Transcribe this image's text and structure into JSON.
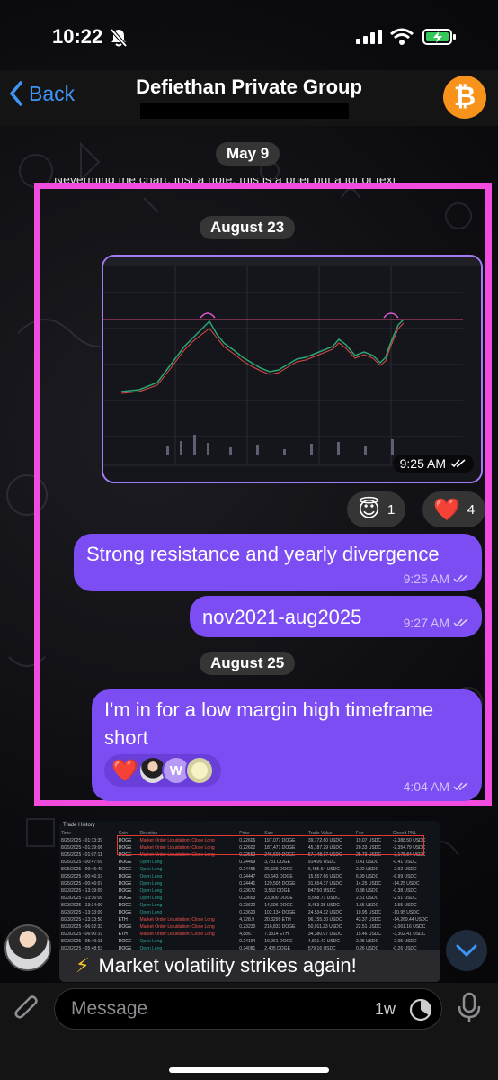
{
  "status_bar": {
    "time": "10:22"
  },
  "nav": {
    "back_label": "Back",
    "title": "Defiethan Private Group",
    "avatar_symbol": "₿",
    "avatar_color": "#f7931a"
  },
  "chat": {
    "date_may": "May 9",
    "date_aug23": "August 23",
    "date_aug25": "August 25",
    "image_time": "9:25 AM",
    "reaction_halo": {
      "emoji": "😇",
      "count": "1"
    },
    "reaction_heart": {
      "emoji": "❤️",
      "count": "4"
    },
    "msg1": {
      "text": "Strong resistance and yearly divergence",
      "time": "9:25 AM"
    },
    "msg2": {
      "text": "nov2021-aug2025",
      "time": "9:27 AM"
    },
    "msg3": {
      "text": "I'm in for a low margin high timeframe short",
      "time": "4:04 AM",
      "reaction": "❤️",
      "reactor_initial": "W"
    },
    "caption": "Market volatility strikes again!",
    "caption_icon": "⚡"
  },
  "trade_history": {
    "title": "Trade History",
    "headers": [
      "Time",
      "Coin",
      "Direction",
      "Price",
      "Size",
      "Trade Value",
      "Fee",
      "Closed PNL"
    ],
    "rows": [
      [
        "8/25/2025 - 01:13:39",
        "DOGE",
        "Market Order Liquidation: Close Long",
        "0.22606",
        "197,077 DOGE",
        "39,772.60 USDC",
        "19.07 USDC",
        "-2,388.50 USDC"
      ],
      [
        "8/25/2025 - 01:39:06",
        "DOGE",
        "Market Order Liquidation: Close Long",
        "0.22602",
        "187,471 DOGE",
        "45,187.29 USDC",
        "20.33 USDC",
        "-2,354.79 USDC"
      ],
      [
        "8/25/2025 - 01:07:11",
        "DOGE",
        "Market Order Liquidation: Close Long",
        "0.22552",
        "246,609 DOGE",
        "57,148.17 USDC",
        "25.73 USDC",
        "-2,175.84 USDC"
      ],
      [
        "8/25/2025 - 00:47:09",
        "DOGE",
        "Open Long",
        "0.24469",
        "3,731 DOGE",
        "914.06 USDC",
        "0.41 USDC",
        "-0.41 USDC"
      ],
      [
        "8/25/2025 - 00:46:49",
        "DOGE",
        "Open Long",
        "0.24465",
        "26,509 DOGE",
        "6,485.64 USDC",
        "2.92 USDC",
        "-2.92 USDC"
      ],
      [
        "8/25/2025 - 00:46:37",
        "DOGE",
        "Open Long",
        "0.24447",
        "63,643 DOGE",
        "15,557.66 USDC",
        "6.99 USDC",
        "-6.99 USDC"
      ],
      [
        "8/25/2025 - 00:46:07",
        "DOGE",
        "Open Long",
        "0.24441",
        "129,505 DOGE",
        "31,654.37 USDC",
        "14.25 USDC",
        "-14.25 USDC"
      ],
      [
        "8/23/2025 - 13:39:09",
        "DOGE",
        "Open Long",
        "0.23672",
        "3,552 DOGE",
        "847.50 USDC",
        "0.38 USDC",
        "-0.38 USDC"
      ],
      [
        "8/23/2025 - 13:36:09",
        "DOGE",
        "Open Long",
        "0.23663",
        "23,300 DOGE",
        "5,568.71 USDC",
        "2.51 USDC",
        "-2.51 USDC"
      ],
      [
        "8/23/2025 - 13:34:09",
        "DOGE",
        "Open Long",
        "0.23622",
        "14,696 DOGE",
        "3,453.25 USDC",
        "1.55 USDC",
        "-1.55 USDC"
      ],
      [
        "8/23/2025 - 13:33:09",
        "DOGE",
        "Open Long",
        "0.23620",
        "102,134 DOGE",
        "24,534.32 USDC",
        "10.95 USDC",
        "-10.95 USDC"
      ],
      [
        "8/23/2025 - 13:33:50",
        "ETH",
        "Market Order Liquidation: Close Long",
        "4,728.9",
        "20.3299 ETH",
        "96,155.30 USDC",
        "43.37 USDC",
        "-14,269.44 USDC"
      ],
      [
        "8/23/2025 - 06:02:33",
        "DOGE",
        "Market Order Liquidation: Close Long",
        "0.23230",
        "216,833 DOGE",
        "50,011.23 USDC",
        "22.51 USDC",
        "-2,061.16 USDC"
      ],
      [
        "8/23/2025 - 06:00:19",
        "ETH",
        "Market Order Liquidation: Close Long",
        "4,886.7",
        "7.3314 ETH",
        "34,380.07 USDC",
        "15.46 USDC",
        "-3,302.41 USDC"
      ],
      [
        "8/23/2025 - 05:49:11",
        "DOGE",
        "Open Long",
        "0.24164",
        "19,961 DOGE",
        "4,831.42 USDC",
        "2.05 USDC",
        "-2.05 USDC"
      ],
      [
        "8/23/2025 - 05:48:53",
        "DOGE",
        "Open Long",
        "0.24081",
        "2,405 DOGE",
        "579.16 USDC",
        "0.26 USDC",
        "-0.26 USDC"
      ]
    ]
  },
  "input": {
    "placeholder": "Message",
    "ttl": "1w"
  },
  "colors": {
    "accent": "#7b4df2",
    "highlight": "#f24be0",
    "link": "#3e95f5"
  }
}
